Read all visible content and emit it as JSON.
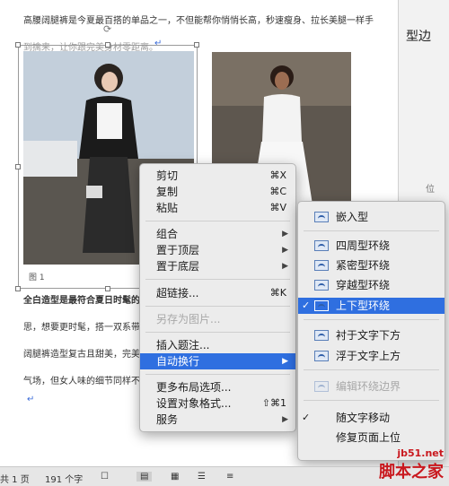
{
  "document": {
    "line1": "高腰阔腿裤是今夏最百搭的单品之一，不但能帮你悄悄长高，秒速瘦身、拉长美腿一样手",
    "line2": "到擒来，让你跟完美身材零距离。",
    "caption": "图 1",
    "body_lines": [
      "全白造型是最符合夏日时髦的",
      "思，想要更时髦，搭一双系带",
      "阔腿裤造型复古且甜美，完美",
      "气场，但女人味的细节同样不"
    ]
  },
  "side_panel": {
    "title": "型边",
    "subtitle": "位"
  },
  "context_menu": {
    "cut": "剪切",
    "cut_shortcut": "⌘X",
    "copy": "复制",
    "copy_shortcut": "⌘C",
    "paste": "粘贴",
    "paste_shortcut": "⌘V",
    "group": "组合",
    "bring_front": "置于顶层",
    "send_back": "置于底层",
    "hyperlink": "超链接...",
    "hyperlink_shortcut": "⌘K",
    "save_as_picture": "另存为图片...",
    "insert_caption": "插入题注...",
    "wrap_text": "自动换行",
    "more_layout": "更多布局选项...",
    "format_object": "设置对象格式...",
    "format_object_shortcut": "⇧⌘1",
    "services": "服务"
  },
  "wrap_submenu": {
    "inline": "嵌入型",
    "square": "四周型环绕",
    "tight": "紧密型环绕",
    "through": "穿越型环绕",
    "top_bottom": "上下型环绕",
    "behind_text": "衬于文字下方",
    "in_front_text": "浮于文字上方",
    "edit_wrap_points": "编辑环绕边界",
    "move_with_text": "随文字移动",
    "fix_position": "修复页面上位"
  },
  "status_bar": {
    "page": "共 1 页",
    "words": "191 个字"
  },
  "watermark": {
    "url": "jb51.net",
    "brand": "脚本之家"
  },
  "colors": {
    "highlight": "#2f6fe0",
    "watermark": "#c9181e"
  }
}
